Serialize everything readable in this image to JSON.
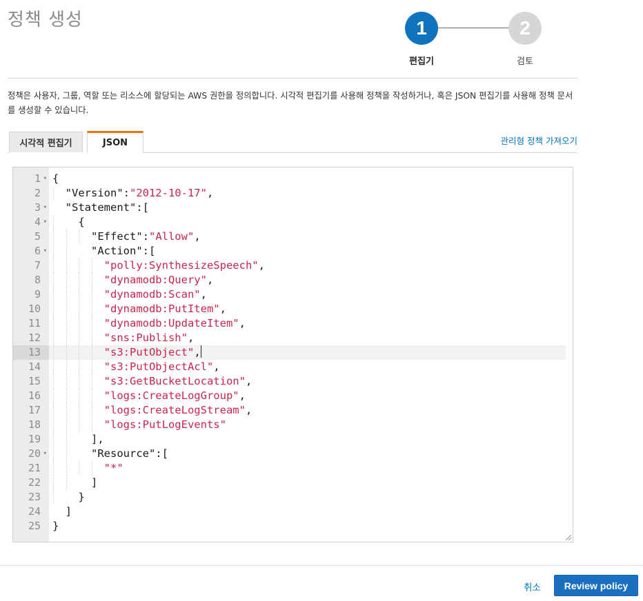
{
  "page": {
    "title": "정책 생성",
    "description": "정책은 사용자, 그룹, 역할 또는 리소스에 할당되는 AWS 권한을 정의합니다. 시각적 편집기를 사용해 정책을 작성하거나, 혹은 JSON 편집기를 사용해 정책 문서를 생성할 수 있습니다."
  },
  "stepper": {
    "steps": [
      {
        "number": "1",
        "label": "편집기",
        "state": "active"
      },
      {
        "number": "2",
        "label": "검토",
        "state": "inactive"
      }
    ],
    "active_color": "#0f73be",
    "inactive_color": "#d6d6d6"
  },
  "tabs": [
    {
      "label": "시각적 편집기",
      "selected": false
    },
    {
      "label": "JSON",
      "selected": true
    }
  ],
  "import_link": "관리형 정책 가져오기",
  "editor": {
    "active_line": 13,
    "lines": [
      {
        "n": "1",
        "fold": true,
        "tokens": [
          [
            "p",
            "{"
          ]
        ]
      },
      {
        "n": "2",
        "tokens": [
          [
            "p",
            "  \"Version\":"
          ],
          [
            "s",
            "\"2012-10-17\""
          ],
          [
            "p",
            ","
          ]
        ]
      },
      {
        "n": "3",
        "fold": true,
        "tokens": [
          [
            "p",
            "  \"Statement\":["
          ]
        ]
      },
      {
        "n": "4",
        "fold": true,
        "tokens": [
          [
            "p",
            "    {"
          ]
        ]
      },
      {
        "n": "5",
        "tokens": [
          [
            "p",
            "      \"Effect\":"
          ],
          [
            "s",
            "\"Allow\""
          ],
          [
            "p",
            ","
          ]
        ]
      },
      {
        "n": "6",
        "fold": true,
        "tokens": [
          [
            "p",
            "      \"Action\":["
          ]
        ]
      },
      {
        "n": "7",
        "tokens": [
          [
            "p",
            "        "
          ],
          [
            "s",
            "\"polly:SynthesizeSpeech\""
          ],
          [
            "p",
            ","
          ]
        ]
      },
      {
        "n": "8",
        "tokens": [
          [
            "p",
            "        "
          ],
          [
            "s",
            "\"dynamodb:Query\""
          ],
          [
            "p",
            ","
          ]
        ]
      },
      {
        "n": "9",
        "tokens": [
          [
            "p",
            "        "
          ],
          [
            "s",
            "\"dynamodb:Scan\""
          ],
          [
            "p",
            ","
          ]
        ]
      },
      {
        "n": "10",
        "tokens": [
          [
            "p",
            "        "
          ],
          [
            "s",
            "\"dynamodb:PutItem\""
          ],
          [
            "p",
            ","
          ]
        ]
      },
      {
        "n": "11",
        "tokens": [
          [
            "p",
            "        "
          ],
          [
            "s",
            "\"dynamodb:UpdateItem\""
          ],
          [
            "p",
            ","
          ]
        ]
      },
      {
        "n": "12",
        "tokens": [
          [
            "p",
            "        "
          ],
          [
            "s",
            "\"sns:Publish\""
          ],
          [
            "p",
            ","
          ]
        ]
      },
      {
        "n": "13",
        "tokens": [
          [
            "p",
            "        "
          ],
          [
            "s",
            "\"s3:PutObject\""
          ],
          [
            "p",
            ","
          ]
        ],
        "caret": true
      },
      {
        "n": "14",
        "tokens": [
          [
            "p",
            "        "
          ],
          [
            "s",
            "\"s3:PutObjectAcl\""
          ],
          [
            "p",
            ","
          ]
        ]
      },
      {
        "n": "15",
        "tokens": [
          [
            "p",
            "        "
          ],
          [
            "s",
            "\"s3:GetBucketLocation\""
          ],
          [
            "p",
            ","
          ]
        ]
      },
      {
        "n": "16",
        "tokens": [
          [
            "p",
            "        "
          ],
          [
            "s",
            "\"logs:CreateLogGroup\""
          ],
          [
            "p",
            ","
          ]
        ]
      },
      {
        "n": "17",
        "tokens": [
          [
            "p",
            "        "
          ],
          [
            "s",
            "\"logs:CreateLogStream\""
          ],
          [
            "p",
            ","
          ]
        ]
      },
      {
        "n": "18",
        "tokens": [
          [
            "p",
            "        "
          ],
          [
            "s",
            "\"logs:PutLogEvents\""
          ]
        ]
      },
      {
        "n": "19",
        "tokens": [
          [
            "p",
            "      ],"
          ]
        ]
      },
      {
        "n": "20",
        "fold": true,
        "tokens": [
          [
            "p",
            "      \"Resource\":["
          ]
        ]
      },
      {
        "n": "21",
        "tokens": [
          [
            "p",
            "        "
          ],
          [
            "s",
            "\"*\""
          ]
        ]
      },
      {
        "n": "22",
        "tokens": [
          [
            "p",
            "      ]"
          ]
        ]
      },
      {
        "n": "23",
        "tokens": [
          [
            "p",
            "    }"
          ]
        ]
      },
      {
        "n": "24",
        "tokens": [
          [
            "p",
            "  ]"
          ]
        ]
      },
      {
        "n": "25",
        "tokens": [
          [
            "p",
            "}"
          ]
        ]
      }
    ]
  },
  "footer": {
    "cancel_label": "취소",
    "review_label": "Review policy"
  },
  "colors": {
    "accent_tab": "#ec7211",
    "link": "#0073bb",
    "primary_button": "#1b6fc0",
    "string": "#c7254e"
  }
}
